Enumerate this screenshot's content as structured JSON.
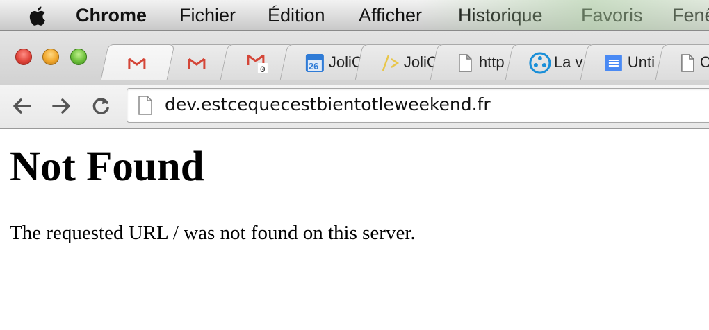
{
  "menubar": {
    "app_name": "Chrome",
    "items": [
      "Fichier",
      "Édition",
      "Afficher",
      "Historique",
      "Favoris",
      "Fenêtre"
    ]
  },
  "tabs": [
    {
      "icon": "gmail-icon",
      "title": ""
    },
    {
      "icon": "gmail-icon",
      "title": ""
    },
    {
      "icon": "gmail-unread-icon",
      "title": "",
      "badge": "0"
    },
    {
      "icon": "calendar-icon",
      "title": "JoliC",
      "badge": "26"
    },
    {
      "icon": "code-icon",
      "title": "JoliC"
    },
    {
      "icon": "page-icon",
      "title": "http"
    },
    {
      "icon": "circles-icon",
      "title": "La v"
    },
    {
      "icon": "docs-icon",
      "title": "Unti"
    },
    {
      "icon": "page-icon",
      "title": "C"
    }
  ],
  "toolbar": {
    "url": "dev.estcequecestbientotleweekend.fr"
  },
  "page": {
    "heading": "Not Found",
    "message": "The requested URL / was not found on this server."
  },
  "colors": {
    "close": "#e0443a",
    "minimize": "#f0a62a",
    "maximize": "#6cbf3a",
    "gmail_red": "#d44638",
    "calendar_blue": "#2f7bd6",
    "circles_blue": "#1a8fd8",
    "docs_blue": "#4a8af4"
  }
}
